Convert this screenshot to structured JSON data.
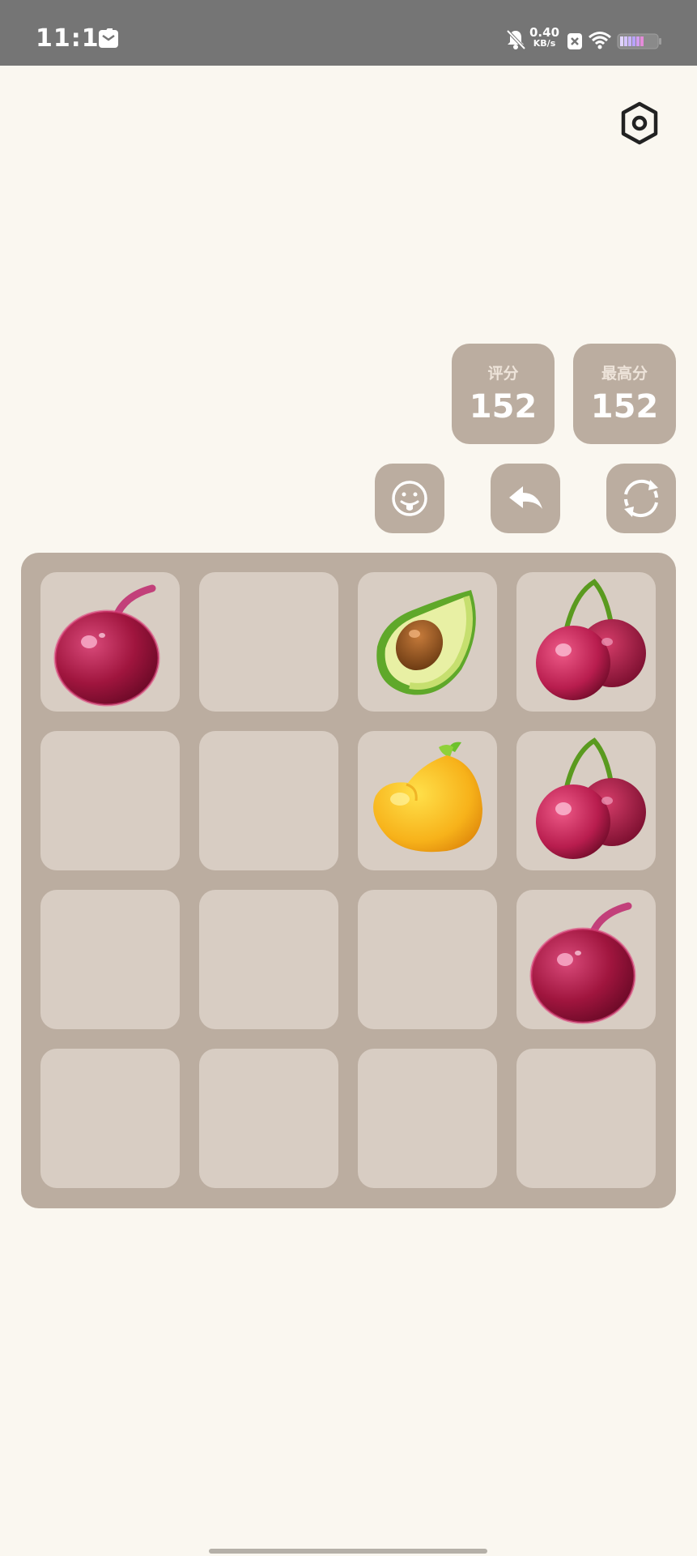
{
  "status_bar": {
    "time": "11:14",
    "net_speed_value": "0.40",
    "net_speed_unit": "KB/s",
    "icons": [
      "mail-icon",
      "bell-off-icon",
      "close-box-icon",
      "wifi-icon",
      "battery-icon"
    ]
  },
  "toolbar": {
    "settings_icon": "settings-icon"
  },
  "scores": {
    "score_label": "评分",
    "score_value": "152",
    "best_label": "最高分",
    "best_value": "152"
  },
  "actions": {
    "emoji_icon": "face-tongue-icon",
    "undo_icon": "undo-arrow-icon",
    "restart_icon": "refresh-icon"
  },
  "board": {
    "rows": [
      [
        "cherry-single",
        "empty",
        "avocado",
        "cherry-double"
      ],
      [
        "empty",
        "empty",
        "mango",
        "cherry-double"
      ],
      [
        "empty",
        "empty",
        "empty",
        "cherry-single"
      ],
      [
        "empty",
        "empty",
        "empty",
        "empty"
      ]
    ]
  },
  "colors": {
    "background": "#faf7f0",
    "board": "#bbada0",
    "cell": "#d8cdc3",
    "status_bar": "#757575"
  }
}
